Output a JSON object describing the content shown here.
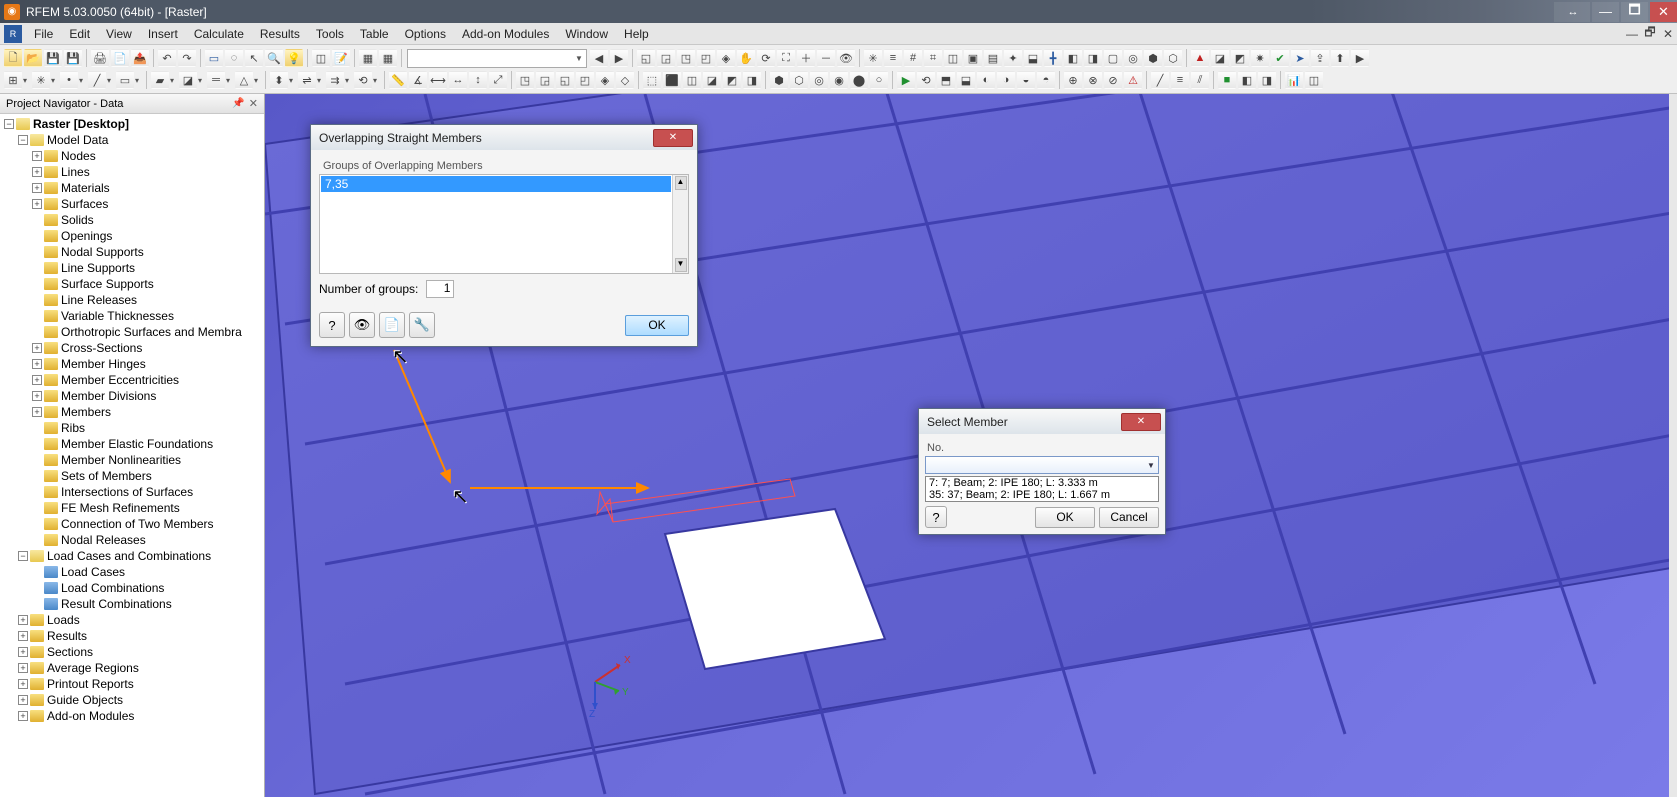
{
  "window": {
    "title": "RFEM 5.03.0050 (64bit) - [Raster]"
  },
  "menu": {
    "items": [
      "File",
      "Edit",
      "View",
      "Insert",
      "Calculate",
      "Results",
      "Tools",
      "Table",
      "Options",
      "Add-on Modules",
      "Window",
      "Help"
    ]
  },
  "navigator": {
    "title": "Project Navigator - Data",
    "root": "Raster [Desktop]",
    "model_data": "Model Data",
    "nodes": [
      "Nodes",
      "Lines",
      "Materials",
      "Surfaces",
      "Solids",
      "Openings",
      "Nodal Supports",
      "Line Supports",
      "Surface Supports",
      "Line Releases",
      "Variable Thicknesses",
      "Orthotropic Surfaces and Membra",
      "Cross-Sections",
      "Member Hinges",
      "Member Eccentricities",
      "Member Divisions",
      "Members",
      "Ribs",
      "Member Elastic Foundations",
      "Member Nonlinearities",
      "Sets of Members",
      "Intersections of Surfaces",
      "FE Mesh Refinements",
      "Connection of Two Members",
      "Nodal Releases"
    ],
    "lcc": "Load Cases and Combinations",
    "lcc_children": [
      "Load Cases",
      "Load Combinations",
      "Result Combinations"
    ],
    "tail": [
      "Loads",
      "Results",
      "Sections",
      "Average Regions",
      "Printout Reports",
      "Guide Objects",
      "Add-on Modules"
    ]
  },
  "dlg1": {
    "title": "Overlapping Straight Members",
    "group_label": "Groups of Overlapping Members",
    "item": "7,35",
    "num_label": "Number of groups:",
    "num_value": "1",
    "ok": "OK"
  },
  "dlg2": {
    "title": "Select Member",
    "no_label": "No.",
    "options": [
      "7: 7; Beam; 2: IPE 180; L: 3.333 m",
      "35: 37; Beam; 2: IPE 180; L: 1.667 m"
    ],
    "ok": "OK",
    "cancel": "Cancel"
  },
  "axis": {
    "x": "X",
    "y": "Y",
    "z": "Z"
  }
}
